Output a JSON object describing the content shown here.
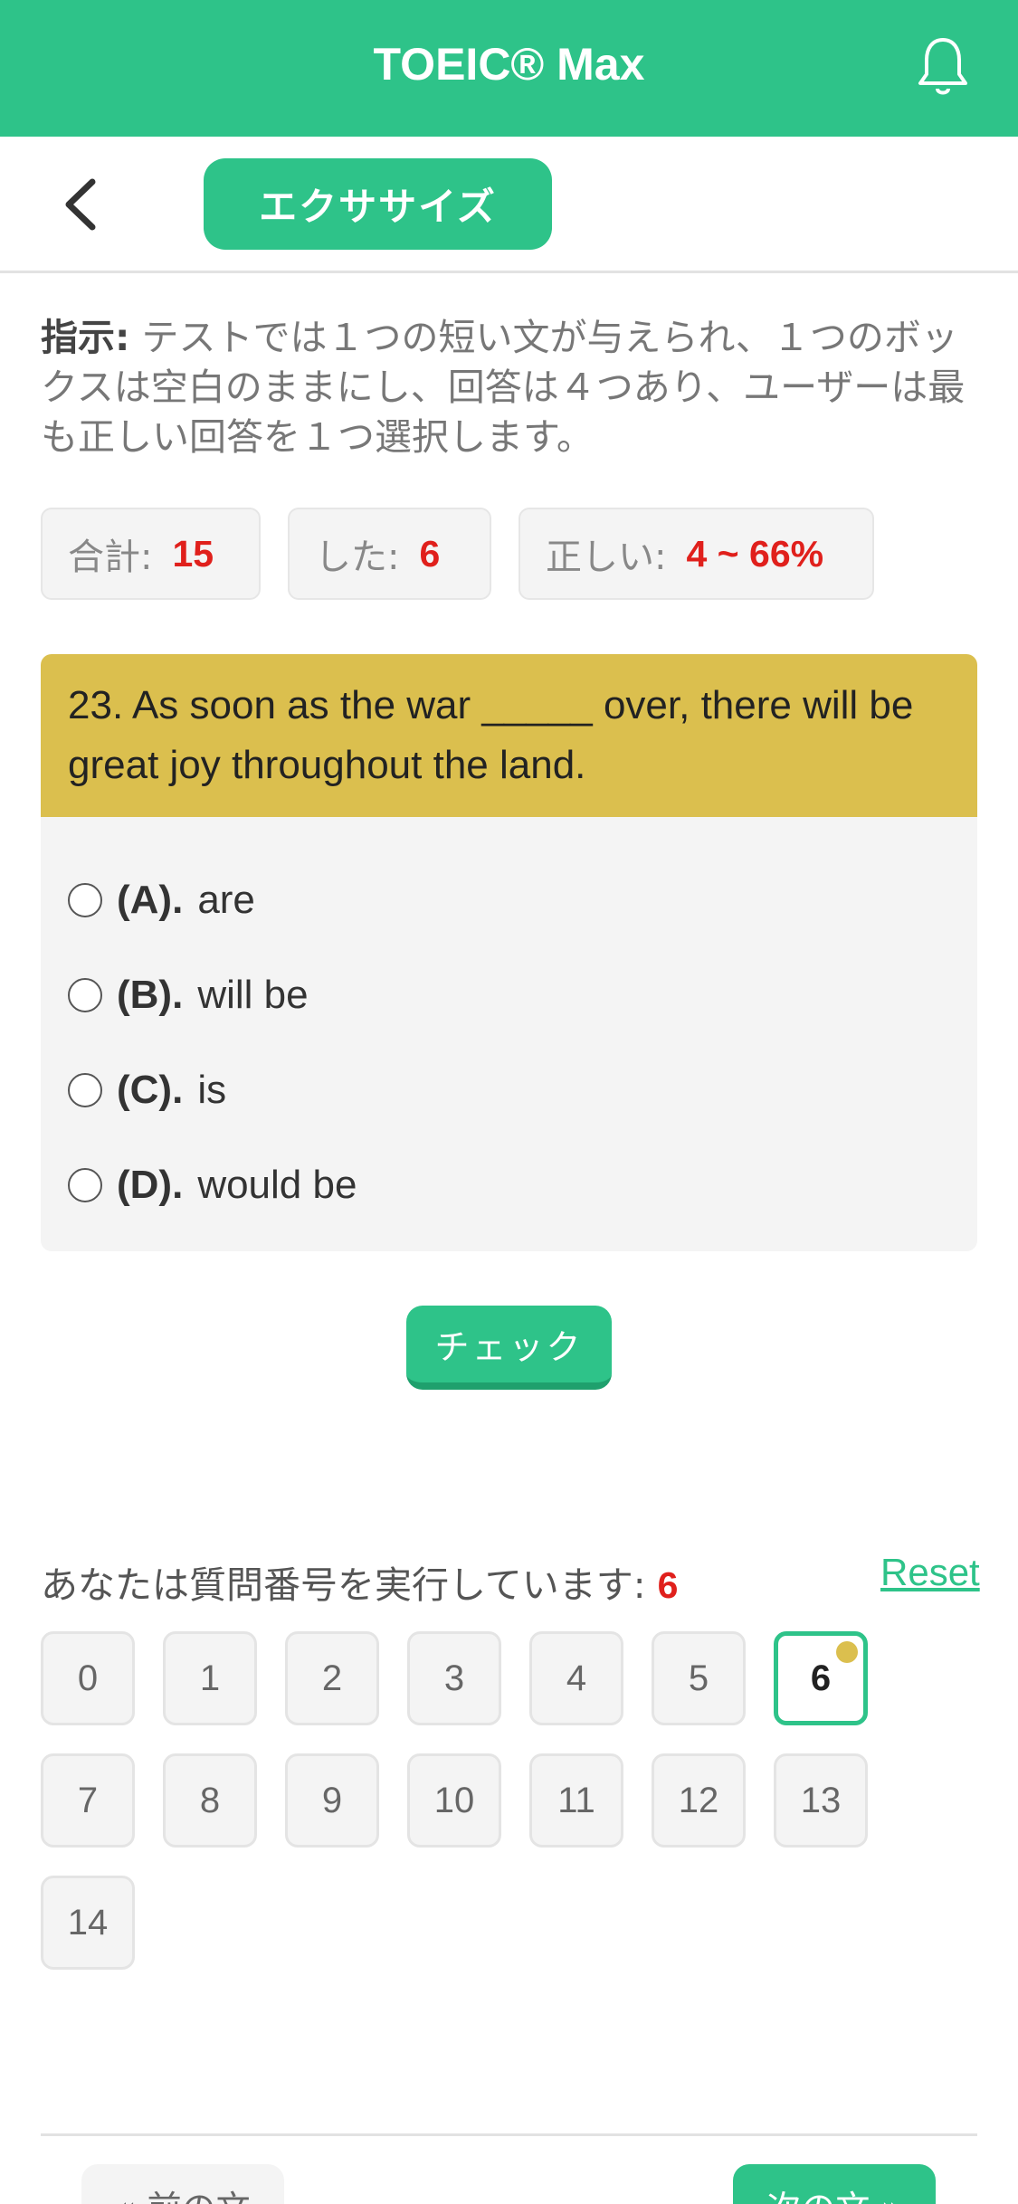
{
  "header": {
    "title": "TOEIC® Max",
    "notification_icon": "bell-icon"
  },
  "subbar": {
    "back_icon": "chevron-left-icon",
    "tab_label": "エクササイズ"
  },
  "instructions": {
    "label": "指示:",
    "text": "テストでは１つの短い文が与えられ、１つのボックスは空白のままにし、回答は４つあり、ユーザーは最も正しい回答を１つ選択します。"
  },
  "stats": {
    "total_label": "合計:",
    "total_value": "15",
    "done_label": "した:",
    "done_value": "6",
    "correct_label": "正しい:",
    "correct_value": "4 ~ 66%"
  },
  "question": {
    "text": "23. As soon as the war _____ over, there will be great joy throughout the land.",
    "options": [
      {
        "letter": "(A).",
        "text": "are"
      },
      {
        "letter": "(B).",
        "text": "will be"
      },
      {
        "letter": "(C).",
        "text": "is"
      },
      {
        "letter": "(D).",
        "text": "would be"
      }
    ],
    "check_label": "チェック"
  },
  "navigator": {
    "running_label": "あなたは質問番号を実行しています:",
    "current": "6",
    "reset_label": "Reset",
    "numbers": [
      "0",
      "1",
      "2",
      "3",
      "4",
      "5",
      "6",
      "7",
      "8",
      "9",
      "10",
      "11",
      "12",
      "13",
      "14"
    ]
  },
  "footer": {
    "prev_label": "« 前の文",
    "next_label": "次の文 »"
  },
  "colors": {
    "brand_green": "#2ec389",
    "question_yellow": "#dbbf4e",
    "accent_red": "#e0201c"
  }
}
